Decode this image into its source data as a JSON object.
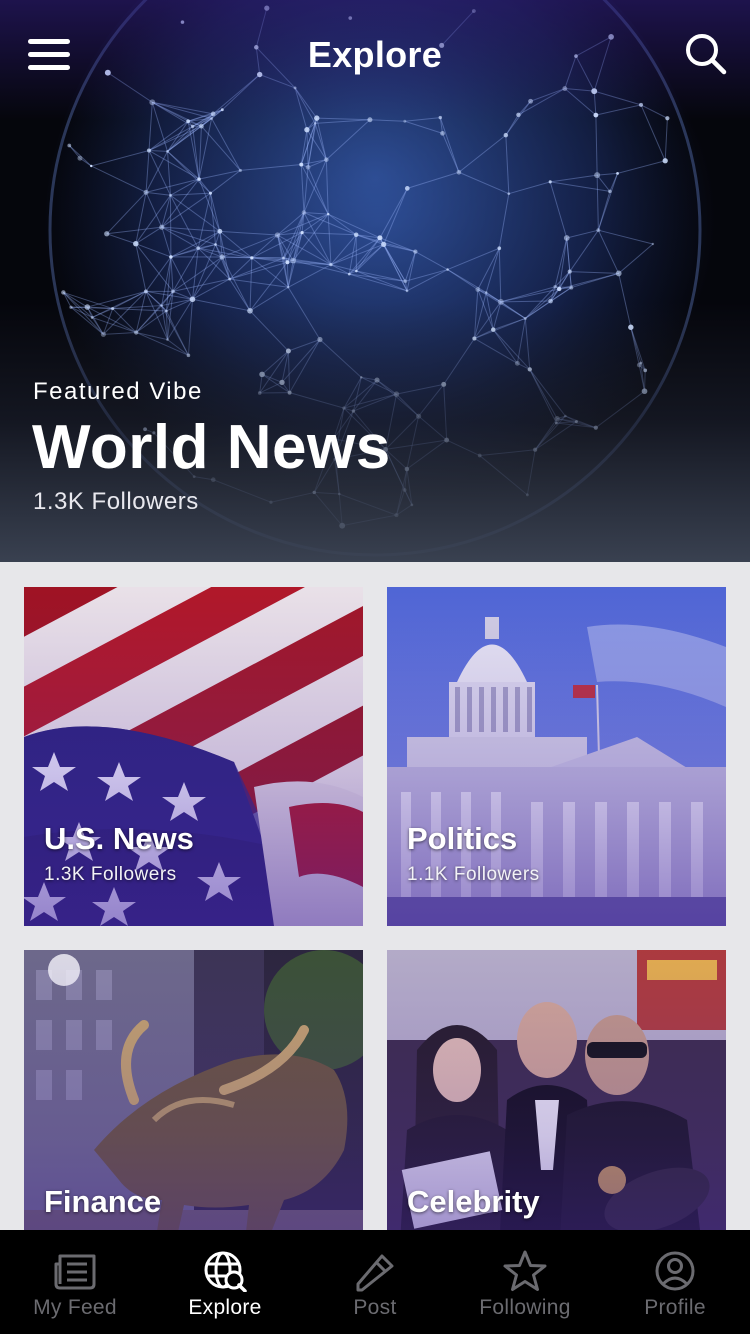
{
  "header": {
    "title": "Explore"
  },
  "featured": {
    "label": "Featured Vibe",
    "title": "World News",
    "followers": "1.3K Followers"
  },
  "grid": [
    {
      "name": "U.S. News",
      "followers": "1.3K Followers"
    },
    {
      "name": "Politics",
      "followers": "1.1K Followers"
    },
    {
      "name": "Finance",
      "followers": ""
    },
    {
      "name": "Celebrity",
      "followers": ""
    }
  ],
  "tabs": [
    {
      "label": "My Feed",
      "icon": "newspaper-icon",
      "active": false
    },
    {
      "label": "Explore",
      "icon": "globe-search-icon",
      "active": true
    },
    {
      "label": "Post",
      "icon": "pencil-icon",
      "active": false
    },
    {
      "label": "Following",
      "icon": "star-icon",
      "active": false
    },
    {
      "label": "Profile",
      "icon": "user-circle-icon",
      "active": false
    }
  ],
  "colors": {
    "tab_active": "#ffffff",
    "tab_inactive": "#6b6b70",
    "tab_bar_bg": "#000000",
    "grid_bg": "#e7e7ea"
  }
}
